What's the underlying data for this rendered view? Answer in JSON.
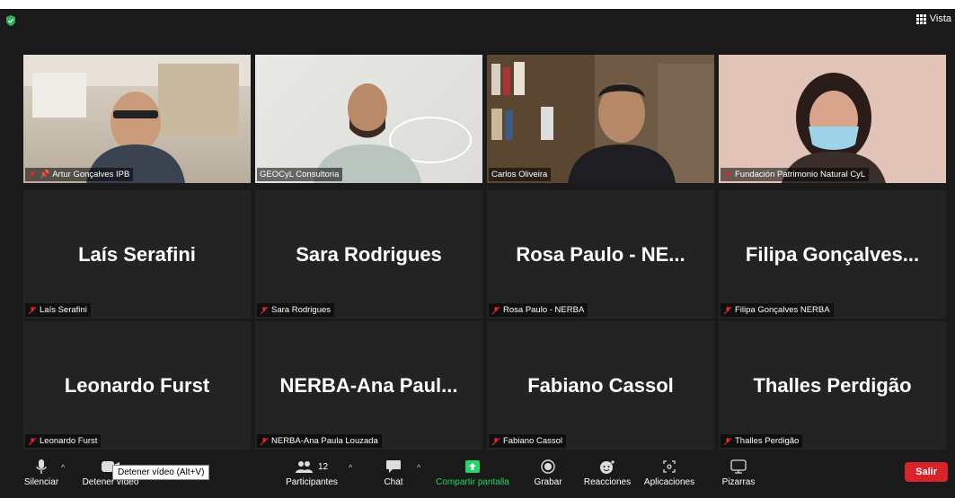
{
  "top": {
    "view_label": "Vista"
  },
  "video_tiles": [
    {
      "label": "Artur Gonçalves IPB",
      "muted": true,
      "pinned": true
    },
    {
      "label": "GEOCyL Consultoria",
      "muted": false,
      "active": true
    },
    {
      "label": "Carlos Oliveira",
      "muted": false
    },
    {
      "label": "Fundación Patrimonio Natural CyL",
      "muted": true
    }
  ],
  "name_tiles": [
    {
      "center": "Laís Serafini",
      "label": "Laís Serafini"
    },
    {
      "center": "Sara Rodrigues",
      "label": "Sara Rodrigues"
    },
    {
      "center": "Rosa Paulo - NE...",
      "label": "Rosa Paulo - NERBA"
    },
    {
      "center": "Filipa  Gonçalves...",
      "label": "Filipa Gonçalves NERBA"
    },
    {
      "center": "Leonardo Furst",
      "label": "Leonardo Furst"
    },
    {
      "center": "NERBA-Ana  Paul...",
      "label": "NERBA-Ana Paula Louzada"
    },
    {
      "center": "Fabiano Cassol",
      "label": "Fabiano Cassol"
    },
    {
      "center": "Thalles Perdigão",
      "label": "Thalles Perdigão"
    }
  ],
  "toolbar": {
    "mute": "Silenciar",
    "stop_video": "Detener vídeo",
    "tooltip": "Detener vídeo (Alt+V)",
    "participants": "Participantes",
    "participants_count": "12",
    "chat": "Chat",
    "share": "Compartir pantalla",
    "record": "Grabar",
    "reactions": "Reacciones",
    "apps": "Aplicaciones",
    "whiteboards": "Pizarras",
    "leave": "Salir"
  },
  "colors": {
    "active_border": "#b8dc3c",
    "share_green": "#25d366",
    "leave_red": "#d8232a",
    "mute_red": "#e02828"
  }
}
